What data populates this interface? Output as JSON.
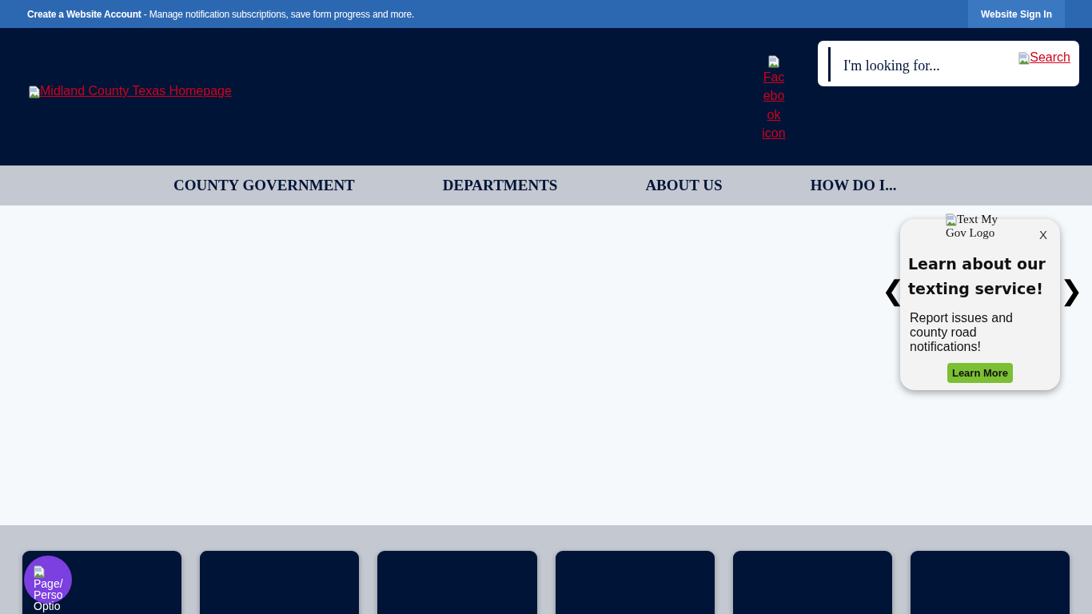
{
  "top_bar": {
    "message": "**Create a Website Account** - Manage notification subscriptions, save form progress and more.",
    "sign_in": "Website Sign In"
  },
  "header": {
    "logo_alt": "Midland County Texas Homepage",
    "social_alt": "Facebook icon",
    "search": {
      "placeholder": "I'm looking for...",
      "button_alt": "Search"
    }
  },
  "nav": [
    "COUNTY GOVERNMENT",
    "DEPARTMENTS",
    "ABOUT US",
    "HOW DO I..."
  ],
  "popup": {
    "logo_alt": "Text My Gov Logo",
    "close": "X",
    "heading": "Learn about our texting service!",
    "body": "Report issues and county road notifications!",
    "button": "Learn More",
    "prev": "❮",
    "next": "❯"
  },
  "cards": [
    {
      "kind": "card"
    },
    {
      "kind": "card"
    },
    {
      "kind": "card"
    },
    {
      "kind": "card"
    },
    {
      "kind": "card"
    },
    {
      "kind": "card"
    }
  ],
  "personalize": {
    "lines": [
      "Page/",
      "Perso",
      "Optio"
    ]
  }
}
